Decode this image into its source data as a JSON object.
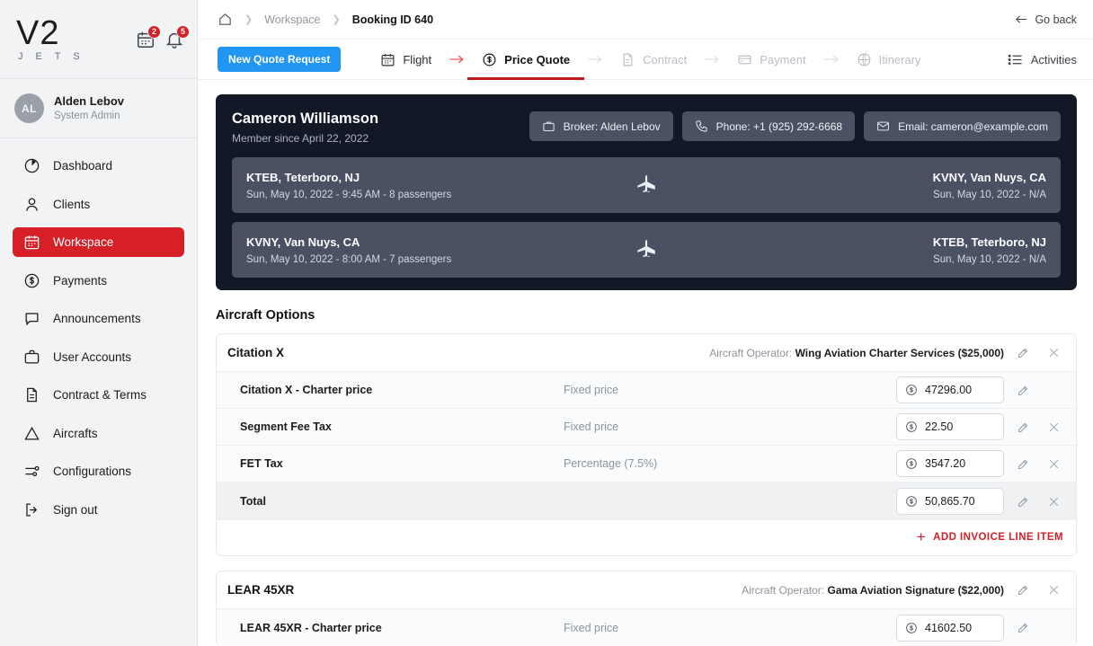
{
  "sidebar": {
    "logo": {
      "main": "V2",
      "sub": "J E T S"
    },
    "header_icons": [
      {
        "name": "calendar-icon",
        "badge": "2"
      },
      {
        "name": "bell-icon",
        "badge": "5"
      }
    ],
    "user": {
      "initials": "AL",
      "name": "Alden Lebov",
      "role": "System Admin"
    },
    "items": [
      {
        "label": "Dashboard",
        "icon": "dashboard-icon",
        "active": false
      },
      {
        "label": "Clients",
        "icon": "person-icon",
        "active": false
      },
      {
        "label": "Workspace",
        "icon": "calendar-icon",
        "active": true
      },
      {
        "label": "Payments",
        "icon": "dollar-circle-icon",
        "active": false
      },
      {
        "label": "Announcements",
        "icon": "chat-icon",
        "active": false
      },
      {
        "label": "User Accounts",
        "icon": "briefcase-icon",
        "active": false
      },
      {
        "label": "Contract & Terms",
        "icon": "document-icon",
        "active": false
      },
      {
        "label": "Aircrafts",
        "icon": "warning-triangle-icon",
        "active": false
      },
      {
        "label": "Configurations",
        "icon": "sliders-icon",
        "active": false
      },
      {
        "label": "Sign out",
        "icon": "logout-icon",
        "active": false
      }
    ]
  },
  "breadcrumb": {
    "home_icon": "home-icon",
    "workspace": "Workspace",
    "current": "Booking ID 640",
    "go_back": "Go back"
  },
  "steps_bar": {
    "new_quote_label": "New Quote Request",
    "activities_label": "Activities",
    "steps": [
      {
        "label": "Flight",
        "icon": "calendar-icon",
        "state": "done"
      },
      {
        "label": "Price Quote",
        "icon": "dollar-circle-icon",
        "state": "current"
      },
      {
        "label": "Contract",
        "icon": "document-icon",
        "state": "pending"
      },
      {
        "label": "Payment",
        "icon": "card-icon",
        "state": "pending"
      },
      {
        "label": "Itinerary",
        "icon": "globe-icon",
        "state": "pending"
      }
    ]
  },
  "booking": {
    "customer_name": "Cameron Williamson",
    "member_since": "Member since April 22, 2022",
    "chips": [
      {
        "icon": "briefcase-icon",
        "text": "Broker: Alden Lebov"
      },
      {
        "icon": "phone-icon",
        "text": "Phone: +1 (925) 292-6668"
      },
      {
        "icon": "mail-icon",
        "text": "Email: cameron@example.com"
      }
    ],
    "legs": [
      {
        "from_code": "KTEB, Teterboro, NJ",
        "from_detail": "Sun, May 10, 2022 - 9:45 AM - 8 passengers",
        "to_code": "KVNY, Van Nuys, CA",
        "to_detail": "Sun, May 10, 2022 - N/A"
      },
      {
        "from_code": "KVNY, Van Nuys, CA",
        "from_detail": "Sun, May 10, 2022 - 8:00 AM - 7 passengers",
        "to_code": "KTEB, Teterboro, NJ",
        "to_detail": "Sun, May 10, 2022 - N/A"
      }
    ]
  },
  "aircraft_options": {
    "title": "Aircraft Options",
    "add_line_label": "ADD INVOICE LINE ITEM",
    "operator_prefix": "Aircraft Operator: ",
    "cards": [
      {
        "name": "Citation X",
        "operator": "Wing Aviation Charter Services ($25,000)",
        "rows": [
          {
            "label": "Citation X - Charter price",
            "type": "Fixed price",
            "price": "47296.00",
            "has_delete": false
          },
          {
            "label": "Segment Fee Tax",
            "type": "Fixed price",
            "price": "22.50",
            "has_delete": true
          },
          {
            "label": "FET Tax",
            "type": "Percentage (7.5%)",
            "price": "3547.20",
            "has_delete": true
          },
          {
            "label": "Total",
            "type": "",
            "price": "50,865.70",
            "has_delete": true,
            "is_total": true
          }
        ]
      },
      {
        "name": "LEAR 45XR",
        "operator": "Gama Aviation Signature ($22,000)",
        "rows": [
          {
            "label": "LEAR 45XR - Charter price",
            "type": "Fixed price",
            "price": "41602.50",
            "has_delete": false
          }
        ]
      }
    ]
  },
  "colors": {
    "brand_red": "#d61f26",
    "accent_blue": "#2196f3",
    "dark_card": "#121826",
    "leg_bg": "#4a5163"
  }
}
